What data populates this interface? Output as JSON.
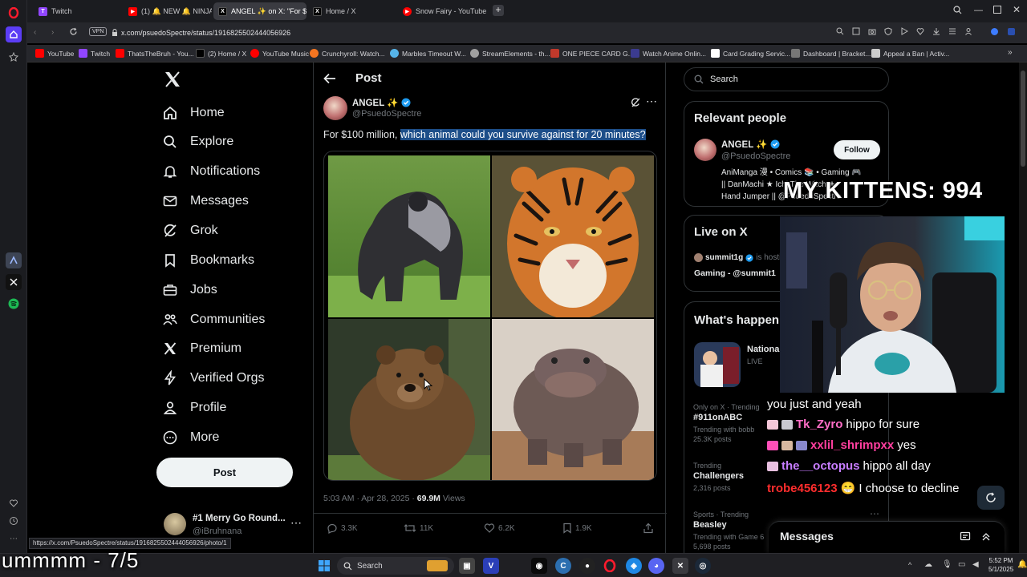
{
  "browser": {
    "tabs": [
      {
        "label": "Twitch",
        "color": "#9146ff",
        "glyph": "T"
      },
      {
        "label": "(1) 🔔 NEW 🔔 NINJAGO",
        "color": "#ff0000",
        "glyph": "▶"
      },
      {
        "label": "ANGEL ✨ on X: \"For $10",
        "color": "#000000",
        "glyph": "X"
      },
      {
        "label": "Home / X",
        "color": "#000000",
        "glyph": "X"
      },
      {
        "label": "Snow Fairy - YouTube",
        "color": "#ff0000",
        "glyph": "▶"
      }
    ],
    "vpn_label": "VPN",
    "url": "x.com/psuedoSpectre/status/1916825502444056926",
    "bookmarks": [
      {
        "label": "YouTube",
        "color": "#ff0000"
      },
      {
        "label": "Twitch",
        "color": "#9146ff"
      },
      {
        "label": "ThatsTheBruh - You...",
        "color": "#ff0000"
      },
      {
        "label": "(2) Home / X",
        "color": "#000000"
      },
      {
        "label": "YouTube Music",
        "color": "#ff0000"
      },
      {
        "label": "Crunchyroll: Watch...",
        "color": "#f47521"
      },
      {
        "label": "Marbles Timeout W...",
        "color": "#56b4e9"
      },
      {
        "label": "StreamElements - th...",
        "color": "#a0a0a0"
      },
      {
        "label": "ONE PIECE CARD G...",
        "color": "#c0392b"
      },
      {
        "label": "Watch Anime Onlin...",
        "color": "#3b3b8f"
      },
      {
        "label": "Card Grading Servic...",
        "color": "#ffffff"
      },
      {
        "label": "Dashboard | Bracket...",
        "color": "#777777"
      },
      {
        "label": "Appeal a Ban | Activ...",
        "color": "#cccccc"
      }
    ],
    "status_url": "https://x.com/PsuedoSpectre/status/1916825502444056926/photo/1"
  },
  "nav": {
    "items": [
      {
        "label": "Home",
        "icon": "home-icon"
      },
      {
        "label": "Explore",
        "icon": "search-icon"
      },
      {
        "label": "Notifications",
        "icon": "bell-icon"
      },
      {
        "label": "Messages",
        "icon": "envelope-icon"
      },
      {
        "label": "Grok",
        "icon": "grok-icon"
      },
      {
        "label": "Bookmarks",
        "icon": "bookmark-icon"
      },
      {
        "label": "Jobs",
        "icon": "briefcase-icon"
      },
      {
        "label": "Communities",
        "icon": "people-icon"
      },
      {
        "label": "Premium",
        "icon": "x-logo-icon"
      },
      {
        "label": "Verified Orgs",
        "icon": "lightning-icon"
      },
      {
        "label": "Profile",
        "icon": "person-icon"
      },
      {
        "label": "More",
        "icon": "more-circle-icon"
      }
    ],
    "post_button": "Post",
    "account_name": "#1 Merry Go Round...",
    "account_handle": "@iBruhnana"
  },
  "post": {
    "header_title": "Post",
    "author_name": "ANGEL ✨",
    "author_handle": "@PsuedoSpectre",
    "text_plain": "For $100 million, ",
    "text_highlight": "which animal could you survive against for 20 minutes?",
    "time": "5:03 AM · Apr 28, 2025 · ",
    "views_count": "69.9M",
    "views_label": " Views",
    "replies": "3.3K",
    "reposts": "11K",
    "likes": "6.2K",
    "bookmarks": "1.9K",
    "images": [
      "gorilla",
      "tiger",
      "brown bear",
      "hippo"
    ]
  },
  "sidebar": {
    "search_placeholder": "Search",
    "relevant_title": "Relevant people",
    "relevant_name": "ANGEL ✨",
    "relevant_handle": "@PsuedoSpectre",
    "follow_label": "Follow",
    "relevant_bio_1": "AniManga 漫 • Comics 📚 • Gaming 🎮",
    "relevant_bio_2": "|| DanMachi ★ Ichi The Witch ★",
    "relevant_bio_3": "Hand Jumper || @PsuedoSpectre",
    "live_title": "Live on X",
    "live_host": "summit1g",
    "live_hosting": " is hosti",
    "live_show": "Gaming - @summit1",
    "happening_title": "What's happen",
    "happening_event": "Nationa",
    "happening_live": "LIVE",
    "trends": [
      {
        "meta": "Only on X · Trending",
        "name": "#911onABC",
        "sub": "Trending with bobb",
        "posts": "25.3K posts"
      },
      {
        "meta": "Trending",
        "name": "Challengers",
        "sub": "",
        "posts": "2,316 posts"
      },
      {
        "meta": "Sports · Trending",
        "name": "Beasley",
        "sub": "Trending with Game 6",
        "posts": "5,698 posts"
      }
    ],
    "messages_label": "Messages"
  },
  "stream": {
    "kitten_label": "MY KITTENS: 994",
    "chat": [
      {
        "name": "",
        "text": "you just and yeah",
        "color": "#ffffff"
      },
      {
        "name": "Tk_Zyro",
        "text": "hippo for sure",
        "color": "#ff6ec7"
      },
      {
        "name": "xxlil_shrimpxx",
        "text": "yes",
        "color": "#ff3f9f"
      },
      {
        "name": "the__octopus",
        "text": "hippo all day",
        "color": "#c77dff"
      },
      {
        "name": "trobe456123",
        "text": "😁 I choose to decline",
        "color": "#ff2d2d"
      }
    ],
    "bottom_overlay": "ummmm - 7/5"
  },
  "taskbar": {
    "search": "Search",
    "time": "5:52 PM",
    "date": "5/1/2025"
  }
}
